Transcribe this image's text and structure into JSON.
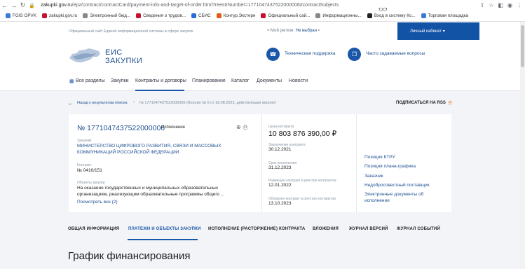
{
  "browser": {
    "url_host": "zakupki.gov.ru",
    "url_path": "/epz/contract/contractCard/payment-info-and-target-of-order.html?reestrNumber=1771047437522000006#contractSubjects",
    "bookmarks": [
      {
        "label": "FGIS OPVK",
        "color": "#3a7bd5"
      },
      {
        "label": "zakupki.gov.ru",
        "color": "#c8102e"
      },
      {
        "label": "Электронный бюд...",
        "color": "#888"
      },
      {
        "label": "Сведения о трудов...",
        "color": "#c8102e"
      },
      {
        "label": "СБИС",
        "color": "#2a6cd8"
      },
      {
        "label": "Контур.Экстерн",
        "color": "#e05a1a"
      },
      {
        "label": "Официальный сай...",
        "color": "#c8102e"
      },
      {
        "label": "Информационны...",
        "color": "#888"
      },
      {
        "label": "Вход в систему Ко...",
        "color": "#222"
      },
      {
        "label": "Торговая площадка",
        "color": "#3a7bd5"
      }
    ]
  },
  "header": {
    "site_info": "Официальный сайт Единой информационной системы в сфере закупок",
    "my_region_label": "Мой регион:",
    "my_region_value": "Не выбран",
    "cabinet": "Личный кабинет",
    "logo_line1": "ЕИС",
    "logo_line2": "ЗАКУПКИ",
    "support": "Техническая поддержка",
    "faq": "Часто задаваемые вопросы"
  },
  "nav": [
    "Все разделы",
    "Закупки",
    "Контракты и договоры",
    "Планирование",
    "Каталог",
    "Документы",
    "Новости"
  ],
  "breadcrumb": {
    "back": "Назад к результатам поиска",
    "current": "№ 1771047437522000006 (Версия № 5 от 18.08.2023, действующая версия)",
    "rss": "ПОДПИСАТЬСЯ НА RSS"
  },
  "card": {
    "number": "№ 1771047437522000006",
    "status": "Исполнение",
    "customer_label": "Заказчик",
    "customer": "МИНИСТЕРСТВО ЦИФРОВОГО РАЗВИТИЯ, СВЯЗИ И МАССОВЫХ КОММУНИКАЦИЙ РОССИЙСКОЙ ФЕДЕРАЦИИ",
    "contract_label": "Контракт",
    "contract": "№ 0410/151",
    "objects_label": "Объекты закупки",
    "objects": "На оказание государственных и муниципальных образовательных организациям, реализующим образовательные программы общего ...",
    "see_all": "Посмотреть все (2)",
    "price_label": "Цена контракта",
    "price": "10 803 876 390,00 ₽",
    "dates": [
      {
        "label": "Заключение контракта",
        "value": "30.12.2021"
      },
      {
        "label": "Срок исполнения",
        "value": "31.12.2023"
      },
      {
        "label": "Размещен контракт в реестре контрактов",
        "value": "12.01.2022"
      },
      {
        "label": "Обновлен контракт в реестре контрактов",
        "value": "13.10.2023"
      }
    ],
    "links": [
      "Позиция КТРУ",
      "Позиция плана-графика",
      "Заказчик",
      "Недобросовестный поставщик",
      "Электронные документы об исполнении"
    ]
  },
  "tabs": [
    "ОБЩАЯ ИНФОРМАЦИЯ",
    "ПЛАТЕЖИ И ОБЪЕКТЫ ЗАКУПКИ",
    "ИСПОЛНЕНИЕ (РАСТОРЖЕНИЕ) КОНТРАКТА",
    "ВЛОЖЕНИЯ",
    "ЖУРНАЛ ВЕРСИЙ",
    "ЖУРНАЛ СОБЫТИЙ"
  ],
  "section_title": "График финансирования"
}
